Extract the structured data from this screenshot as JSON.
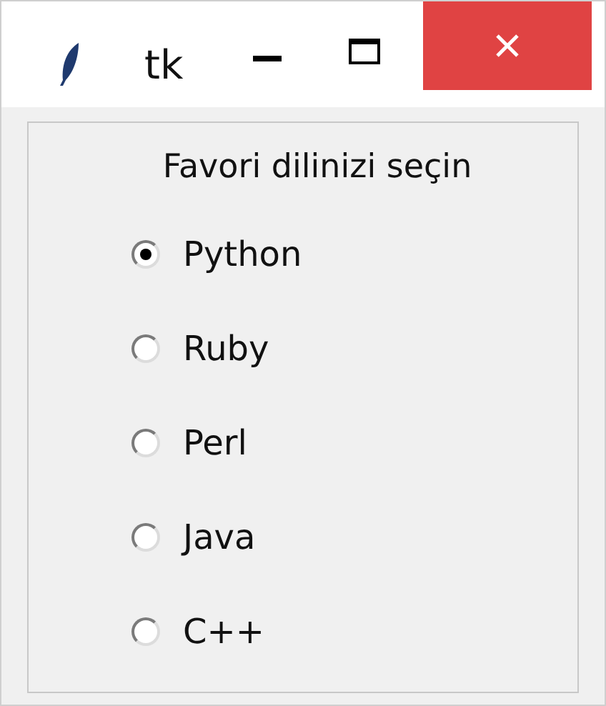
{
  "window": {
    "title": "tk"
  },
  "frame": {
    "label": "Favori dilinizi seçin",
    "options": [
      {
        "label": "Python",
        "selected": true
      },
      {
        "label": "Ruby",
        "selected": false
      },
      {
        "label": "Perl",
        "selected": false
      },
      {
        "label": "Java",
        "selected": false
      },
      {
        "label": "C++",
        "selected": false
      }
    ]
  }
}
